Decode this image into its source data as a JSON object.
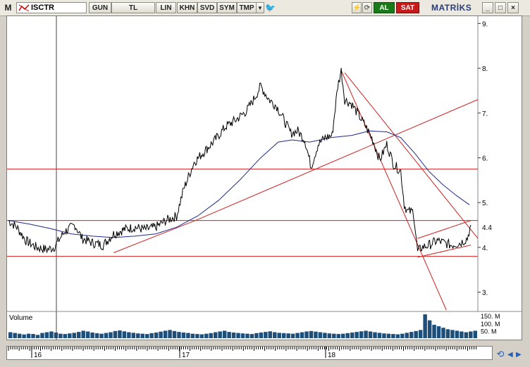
{
  "toolbar": {
    "m_label": "M",
    "symbol": "ISCTR",
    "buttons": [
      "GUN",
      "TL",
      "LIN",
      "KHN",
      "SVD",
      "SYM",
      "TMP"
    ],
    "buy_label": "AL",
    "sell_label": "SAT",
    "brand": "MATRİKS",
    "window_controls": [
      "_",
      "□",
      "×"
    ]
  },
  "colors": {
    "price": "#000000",
    "moving_average": "#1f2a8c",
    "trendlines": "#d02020",
    "volume": "#1d4f7a",
    "buy": "#1a7a1a",
    "sell": "#c81a1a"
  },
  "chart_data": {
    "type": "line",
    "symbol": "ISCTR",
    "y_axis": {
      "ticks": [
        3,
        4,
        5,
        6,
        7,
        8,
        9
      ],
      "range": [
        2.6,
        9.1
      ],
      "current_price_label": "4.4"
    },
    "x_axis": {
      "labels": [
        "16",
        "17",
        "18"
      ]
    },
    "price_series": {
      "name": "ISCTR",
      "points": [
        [
          0,
          4.6
        ],
        [
          12,
          4.45
        ],
        [
          25,
          4.15
        ],
        [
          40,
          4.0
        ],
        [
          55,
          3.95
        ],
        [
          65,
          4.0
        ],
        [
          80,
          4.35
        ],
        [
          95,
          4.5
        ],
        [
          105,
          4.2
        ],
        [
          120,
          4.1
        ],
        [
          135,
          4.05
        ],
        [
          150,
          4.3
        ],
        [
          165,
          4.4
        ],
        [
          180,
          4.45
        ],
        [
          195,
          4.4
        ],
        [
          210,
          4.45
        ],
        [
          225,
          4.6
        ],
        [
          240,
          4.7
        ],
        [
          250,
          5.3
        ],
        [
          265,
          5.9
        ],
        [
          280,
          6.15
        ],
        [
          295,
          6.4
        ],
        [
          310,
          6.7
        ],
        [
          325,
          6.85
        ],
        [
          340,
          7.05
        ],
        [
          350,
          7.3
        ],
        [
          360,
          7.6
        ],
        [
          372,
          7.3
        ],
        [
          383,
          7.15
        ],
        [
          393,
          6.85
        ],
        [
          403,
          6.55
        ],
        [
          413,
          6.6
        ],
        [
          423,
          6.4
        ],
        [
          432,
          5.8
        ],
        [
          442,
          6.3
        ],
        [
          452,
          6.45
        ],
        [
          462,
          6.5
        ],
        [
          470,
          7.6
        ],
        [
          475,
          7.95
        ],
        [
          480,
          7.3
        ],
        [
          490,
          7.2
        ],
        [
          500,
          6.95
        ],
        [
          510,
          6.7
        ],
        [
          520,
          6.4
        ],
        [
          530,
          5.95
        ],
        [
          540,
          6.3
        ],
        [
          550,
          5.85
        ],
        [
          560,
          5.7
        ],
        [
          565,
          4.95
        ],
        [
          570,
          4.8
        ],
        [
          578,
          4.8
        ],
        [
          584,
          3.9
        ],
        [
          590,
          4.0
        ],
        [
          600,
          4.05
        ],
        [
          612,
          4.15
        ],
        [
          622,
          4.1
        ],
        [
          632,
          4.05
        ],
        [
          645,
          4.1
        ],
        [
          655,
          4.2
        ],
        [
          660,
          4.5
        ]
      ]
    },
    "moving_average": {
      "name": "MA",
      "points": [
        [
          0,
          4.6
        ],
        [
          30,
          4.52
        ],
        [
          60,
          4.42
        ],
        [
          90,
          4.3
        ],
        [
          120,
          4.25
        ],
        [
          150,
          4.22
        ],
        [
          180,
          4.25
        ],
        [
          210,
          4.3
        ],
        [
          240,
          4.45
        ],
        [
          270,
          4.7
        ],
        [
          300,
          5.05
        ],
        [
          330,
          5.5
        ],
        [
          360,
          6.0
        ],
        [
          385,
          6.35
        ],
        [
          405,
          6.4
        ],
        [
          430,
          6.35
        ],
        [
          460,
          6.45
        ],
        [
          490,
          6.5
        ],
        [
          515,
          6.6
        ],
        [
          540,
          6.58
        ],
        [
          560,
          6.45
        ],
        [
          580,
          6.1
        ],
        [
          600,
          5.7
        ],
        [
          620,
          5.4
        ],
        [
          640,
          5.15
        ],
        [
          658,
          4.95
        ]
      ]
    },
    "horizontal_lines": [
      5.75,
      4.6,
      3.8
    ],
    "trendlines": [
      {
        "from": [
          150,
          3.88
        ],
        "to": [
          270,
          4.62
        ]
      },
      {
        "from": [
          270,
          4.62
        ],
        "to": [
          670,
          7.3
        ]
      },
      {
        "from": [
          475,
          7.95
        ],
        "to": [
          625,
          2.6
        ]
      },
      {
        "from": [
          480,
          7.9
        ],
        "to": [
          670,
          4.2
        ]
      },
      {
        "from": [
          584,
          3.78
        ],
        "to": [
          660,
          4.05
        ]
      },
      {
        "from": [
          584,
          4.2
        ],
        "to": [
          660,
          4.6
        ]
      }
    ],
    "volume": {
      "label": "Volume",
      "ticks": [
        "150. M",
        "100. M",
        "50. M"
      ],
      "range": [
        0,
        170
      ],
      "values": [
        40,
        35,
        30,
        25,
        30,
        28,
        22,
        35,
        40,
        45,
        38,
        30,
        28,
        32,
        36,
        42,
        50,
        45,
        38,
        33,
        30,
        35,
        40,
        48,
        52,
        46,
        40,
        36,
        32,
        30,
        28,
        34,
        38,
        44,
        50,
        55,
        48,
        42,
        38,
        35,
        30,
        28,
        26,
        30,
        34,
        40,
        45,
        50,
        42,
        38,
        35,
        32,
        30,
        28,
        34,
        38,
        42,
        46,
        40,
        36,
        34,
        32,
        30,
        35,
        40,
        45,
        48,
        44,
        40,
        36,
        32,
        30,
        28,
        30,
        34,
        38,
        42,
        46,
        50,
        45,
        40,
        36,
        32,
        30,
        28,
        26,
        30,
        36,
        42,
        48,
        55,
        160,
        120,
        90,
        80,
        70,
        60,
        55,
        50,
        45,
        40,
        45,
        50
      ]
    }
  }
}
